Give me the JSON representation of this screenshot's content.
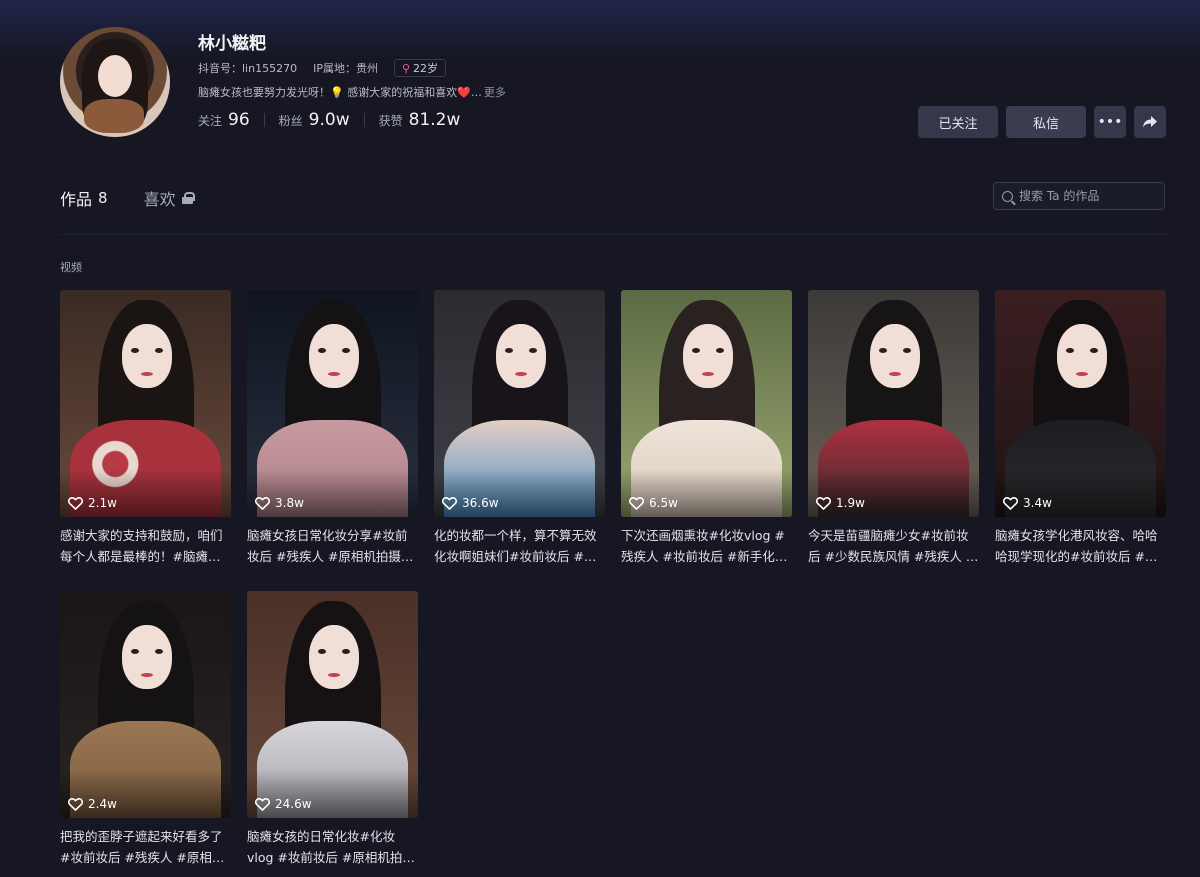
{
  "profile": {
    "name": "林小糍粑",
    "douyin_id_label": "抖音号：",
    "douyin_id": "lin155270",
    "ip_label": "IP属地：",
    "ip_location": "贵州",
    "age": "22岁",
    "bio": "脑瘫女孩也要努力发光呀！💡 感谢大家的祝福和喜欢❤️…",
    "bio_more": "更多",
    "stats": {
      "following_label": "关注",
      "following": "96",
      "fans_label": "粉丝",
      "fans": "9.0w",
      "likes_label": "获赞",
      "likes": "81.2w"
    }
  },
  "actions": {
    "followed_label": "已关注",
    "message_label": "私信",
    "more_icon": "more-icon",
    "share_icon": "share-icon"
  },
  "tabs": {
    "works_label": "作品",
    "works_count": "8",
    "likes_label": "喜欢"
  },
  "search": {
    "placeholder": "搜索 Ta 的作品"
  },
  "section_label": "视频",
  "videos": [
    {
      "likes": "2.1w",
      "caption": "感谢大家的支持和鼓励，咱们每个人都是最棒的！#脑瘫…",
      "theme": "floral"
    },
    {
      "likes": "3.8w",
      "caption": "脑瘫女孩日常化妆分享#妆前妆后 #残疾人 #原相机拍摄 #…",
      "theme": "scarf-pink"
    },
    {
      "likes": "36.6w",
      "caption": "化的妆都一个样，算不算无效化妆啊姐妹们#妆前妆后 #原…",
      "theme": "blue"
    },
    {
      "likes": "6.5w",
      "caption": "下次还画烟熏妆#化妆vlog #残疾人 #妆前妆后 #新手化…",
      "theme": "coat"
    },
    {
      "likes": "1.9w",
      "caption": "今天是苗疆脑瘫少女#妆前妆后 #少数民族风情 #残疾人 …",
      "theme": "ethnic"
    },
    {
      "likes": "3.4w",
      "caption": "脑瘫女孩学化港风妆容、哈哈哈现学现化的#妆前妆后 #复…",
      "theme": "leather"
    },
    {
      "likes": "2.4w",
      "caption": "把我的歪脖子遮起来好看多了#妆前妆后 #残疾人 #原相机…",
      "theme": "teddy"
    },
    {
      "likes": "24.6w",
      "caption": "脑瘫女孩的日常化妆#化妆vlog #妆前妆后 #原相机拍…",
      "theme": "chain"
    }
  ]
}
